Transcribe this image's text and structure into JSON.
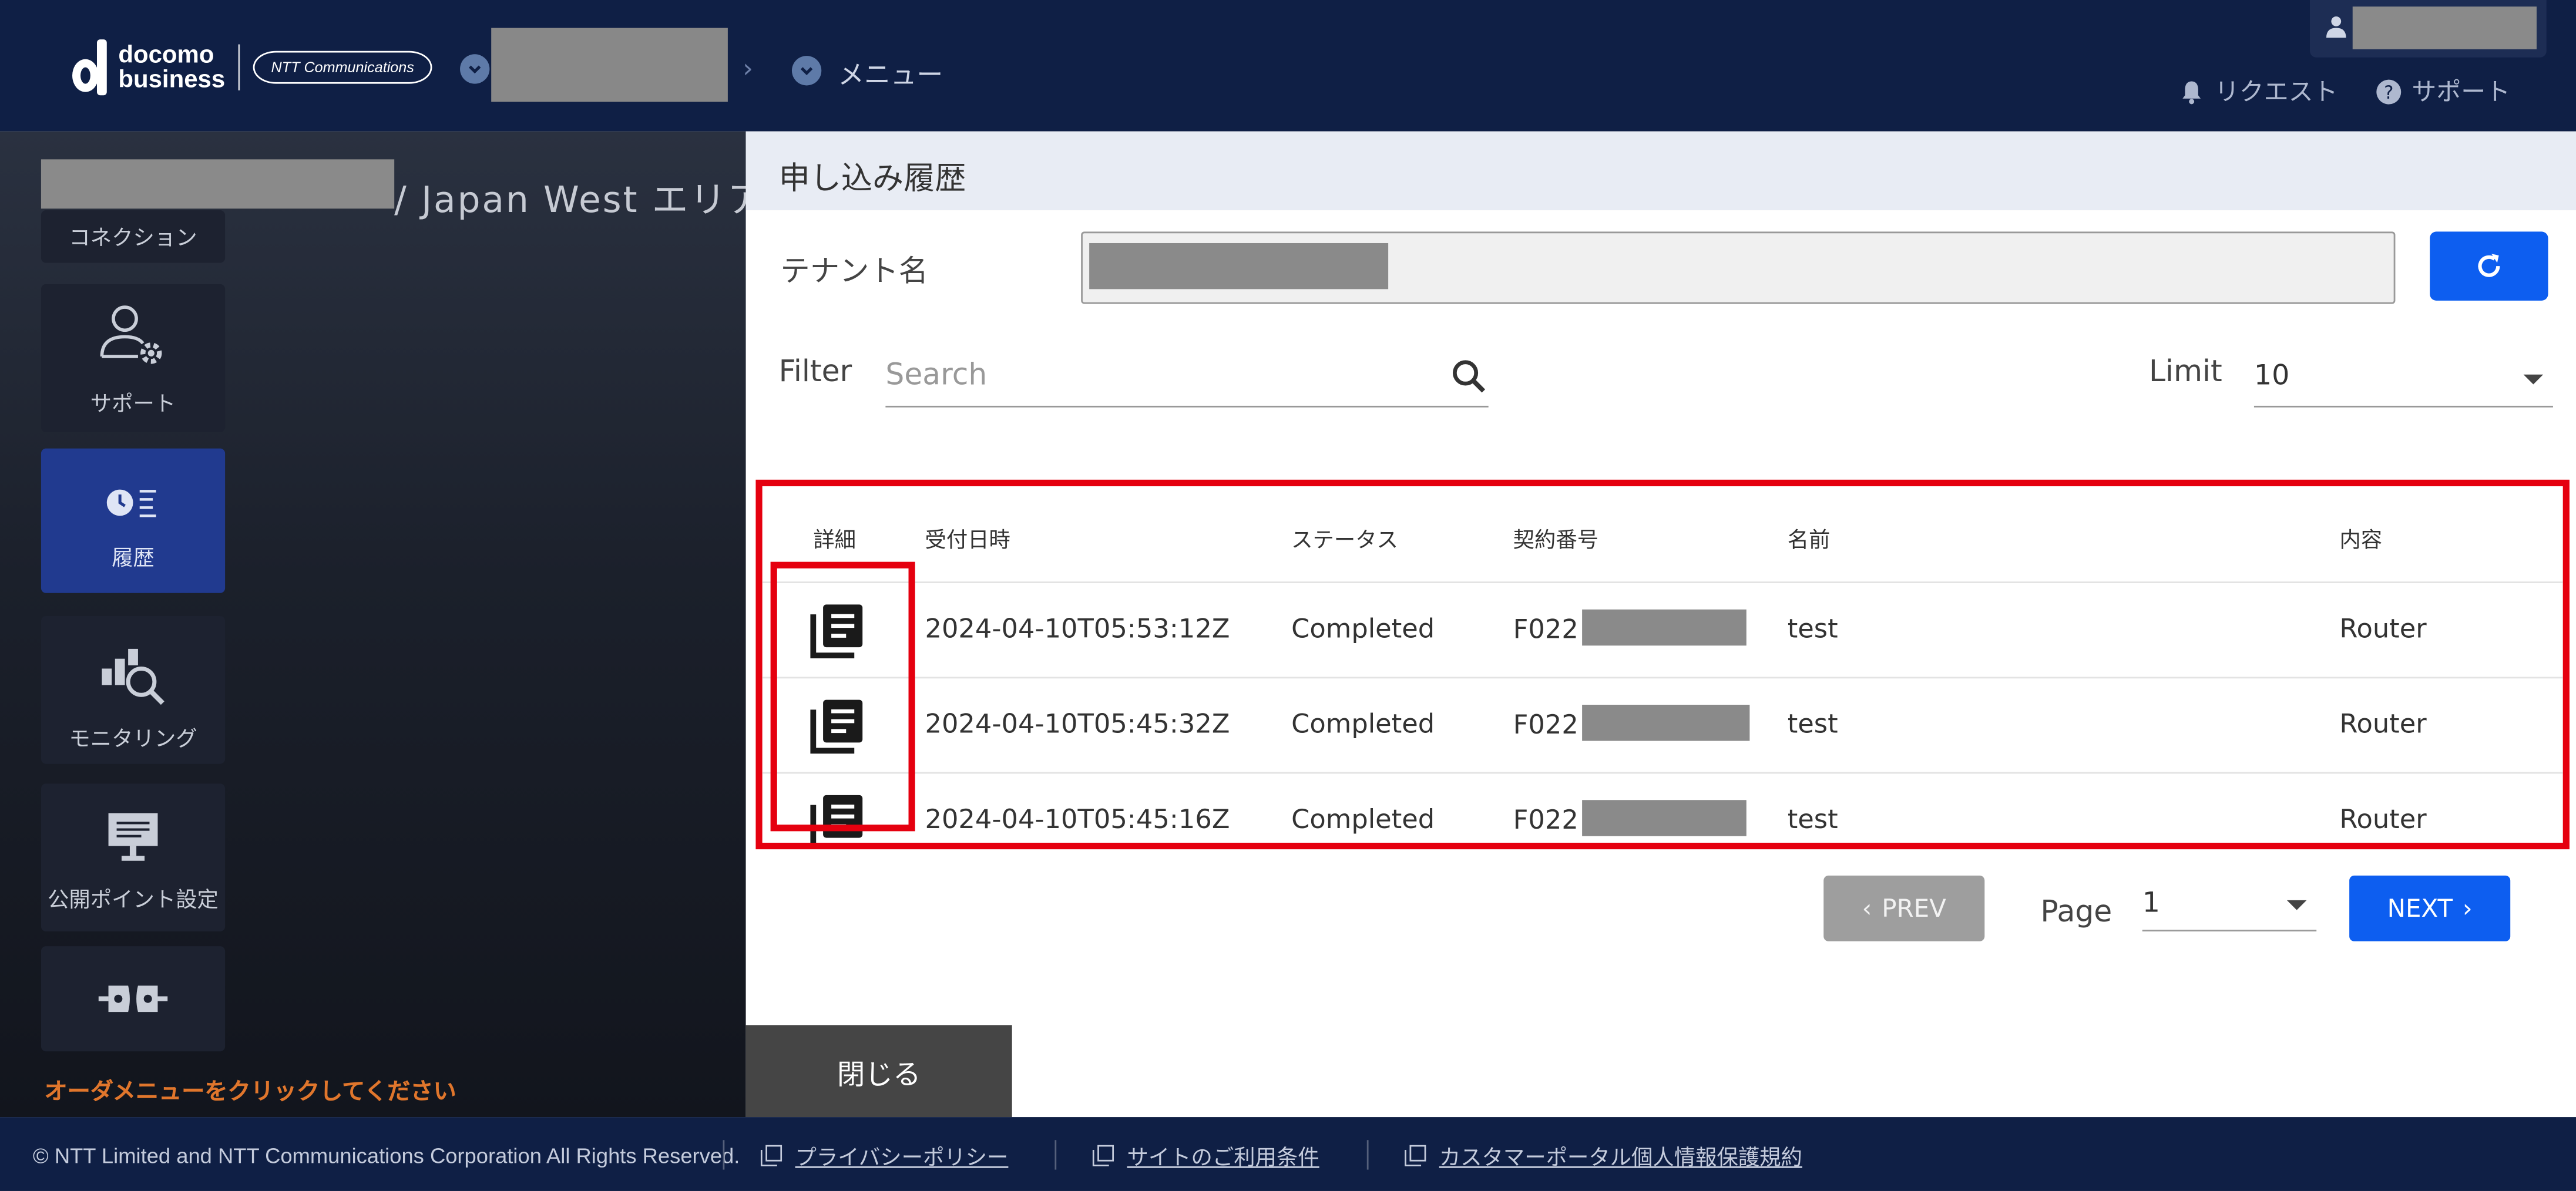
{
  "header": {
    "brand_top": "docomo",
    "brand_bottom": "business",
    "ntt_logo": "NTT Communications",
    "breadcrumb_menu": "メニュー",
    "nav_request": "リクエスト",
    "nav_support": "サポート"
  },
  "sidebar": {
    "region_title": "/ Japan West エリア",
    "items": [
      {
        "label": "コネクション",
        "icon": "connection-icon"
      },
      {
        "label": "サポート",
        "icon": "support-user-gear-icon"
      },
      {
        "label": "履歴",
        "icon": "history-clock-icon",
        "active": true
      },
      {
        "label": "モニタリング",
        "icon": "monitoring-chart-search-icon"
      },
      {
        "label": "公開ポイント設定",
        "icon": "monitor-icon"
      },
      {
        "label": "",
        "icon": "plug-connect-icon"
      }
    ],
    "note": "オーダメニューをクリックしてください"
  },
  "panel": {
    "title": "申し込み履歴",
    "tenant_label": "テナント名",
    "filter_label": "Filter",
    "search_placeholder": "Search",
    "limit_label": "Limit",
    "limit_value": "10",
    "table": {
      "headers": [
        "詳細",
        "受付日時",
        "ステータス",
        "契約番号",
        "名前",
        "内容"
      ],
      "rows": [
        {
          "date": "2024-04-10T05:53:12Z",
          "status": "Completed",
          "contract_prefix": "F022",
          "name": "test",
          "content": "Router"
        },
        {
          "date": "2024-04-10T05:45:32Z",
          "status": "Completed",
          "contract_prefix": "F022",
          "name": "test",
          "content": "Router"
        },
        {
          "date": "2024-04-10T05:45:16Z",
          "status": "Completed",
          "contract_prefix": "F022",
          "name": "test",
          "content": "Router"
        }
      ]
    },
    "prev_label": "PREV",
    "page_label": "Page",
    "page_value": "1",
    "next_label": "NEXT",
    "close_label": "閉じる"
  },
  "footer": {
    "copyright": "© NTT Limited and NTT Communications Corporation All Rights Reserved.",
    "links": [
      "プライバシーポリシー",
      "サイトのご利用条件",
      "カスタマーポータル個人情報保護規約"
    ]
  },
  "colors": {
    "header_bg": "#0f1f45",
    "accent_blue": "#0d5ef0",
    "highlight_red": "#e5000f",
    "note_orange": "#e0762c",
    "sidebar_active": "#213a8f"
  }
}
